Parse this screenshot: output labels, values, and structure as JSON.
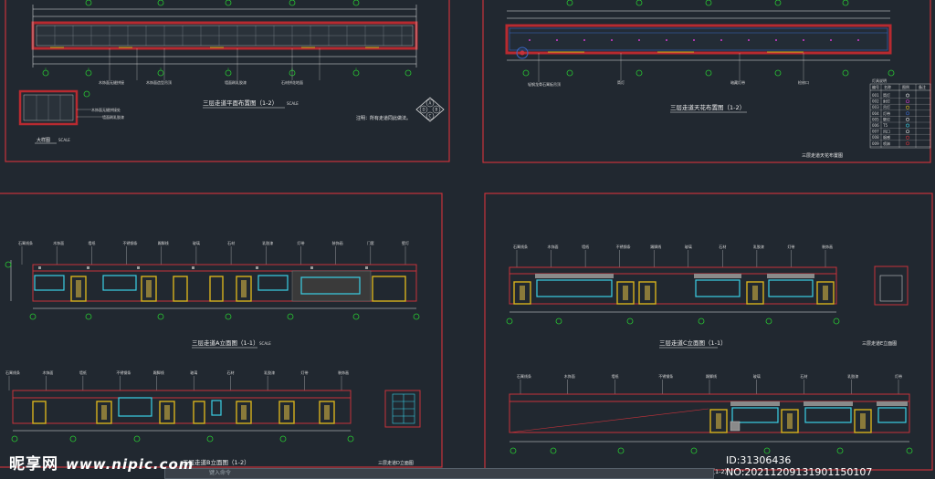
{
  "panels": {
    "top_left": {
      "title": "三层走道平面布置图（1-2）",
      "title_scale": "SCALE",
      "note": "注明：所有走道同此做法。",
      "detail_title": "大样图",
      "detail_scale": "SCALE",
      "callouts": [
        "木饰面无缝拼接",
        "木饰面造型吊顶",
        "墙面刷乳胶漆",
        "墙纸饰面",
        "石材拼花地面",
        "踢脚线",
        "地毯铺贴",
        "大理石波打线"
      ],
      "detail_callouts": [
        "木饰面无缝拼接处",
        "墙面刷乳胶漆"
      ],
      "compass_letters": [
        "A",
        "B",
        "C",
        "D"
      ]
    },
    "top_right": {
      "title": "三层走道天花布置图（1-2）",
      "subtitle": "三层走道天花布置图",
      "legend_title": "灯具说明",
      "legend_headers": [
        "编号",
        "名称",
        "图例",
        "备注"
      ],
      "legend_rows": [
        [
          "001",
          "筒灯",
          ""
        ],
        [
          "002",
          "射灯",
          ""
        ],
        [
          "003",
          "吊灯",
          ""
        ],
        [
          "004",
          "灯带",
          ""
        ],
        [
          "005",
          "壁灯",
          ""
        ],
        [
          "006",
          "T5",
          ""
        ],
        [
          "007",
          "风口",
          ""
        ],
        [
          "008",
          "烟感",
          ""
        ],
        [
          "009",
          "喷淋",
          ""
        ]
      ],
      "callouts": [
        "轻钢龙骨石膏板吊顶",
        "乳胶漆",
        "筒灯",
        "暗藏灯带",
        "检修口"
      ]
    },
    "mid_left": {
      "title": "三层走道A立面图（1-1）",
      "scale": "SCALE",
      "callouts": [
        "石膏线条",
        "木饰面",
        "墙纸",
        "不锈钢条",
        "踢脚线",
        "玻璃",
        "石材",
        "乳胶漆",
        "灯带",
        "装饰画",
        "门套",
        "壁灯"
      ]
    },
    "mid_right": {
      "title": "三层走道C立面图（1-1）",
      "side_title": "三层走道E立面图",
      "callouts": [
        "石膏线条",
        "木饰面",
        "墙纸",
        "不锈钢条",
        "踢脚线",
        "玻璃",
        "石材",
        "乳胶漆",
        "灯带",
        "装饰画"
      ]
    },
    "bot_left": {
      "title": "三层走道B立面图（1-2）",
      "side_title": "三层走道D立面图",
      "callouts": [
        "石膏线条",
        "木饰面",
        "墙纸",
        "不锈钢条",
        "踢脚线",
        "玻璃",
        "石材",
        "乳胶漆",
        "灯带",
        "装饰画"
      ]
    },
    "bot_right": {
      "title": "三层走道D立面图（1-2）",
      "callouts": [
        "石膏线条",
        "木饰面",
        "墙纸",
        "不锈钢条",
        "踢脚线",
        "玻璃",
        "石材",
        "乳胶漆",
        "灯带"
      ]
    }
  },
  "grid_numbers": [
    "1",
    "2",
    "3",
    "4",
    "5",
    "6",
    "7",
    "8"
  ],
  "watermark": {
    "brand": "昵享网",
    "site": "www.nipic.com",
    "id_text": "ID:31306436 NO:20211209131901150107"
  },
  "command_bar": {
    "placeholder": "键入命令"
  },
  "colors": {
    "background": "#212830",
    "frame_red": "#c8323a",
    "wall_red": "#b82a30",
    "line_white": "#e6e6e6",
    "grid_green": "#28c832",
    "door_yellow": "#d8b21c",
    "glass_cyan": "#3ad0e6",
    "hatch_grey": "#8a8a8a",
    "light_magenta": "#d43cd0"
  }
}
